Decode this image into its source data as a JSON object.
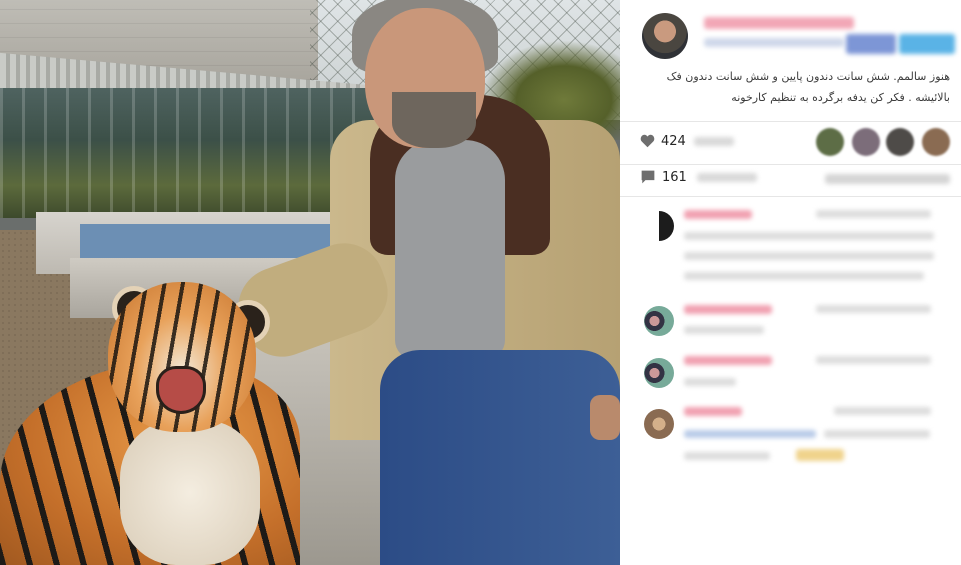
{
  "post": {
    "author_avatar": "avatar",
    "caption": "هنوز سالمم. شش سانت دندون پایین و شش سانت دندون فک بالائیشه . فکر کن یدفه برگرده به تنظیم کارخونه",
    "likes_count": "424",
    "comments_count": "161",
    "like_icon": "heart-icon",
    "comment_icon": "speech-bubble-icon"
  },
  "photo": {
    "subject": "tiger-and-man"
  },
  "colors": {
    "follow_button": "#3897f0",
    "username": "#e0516e",
    "text": "#3c3c3c"
  }
}
